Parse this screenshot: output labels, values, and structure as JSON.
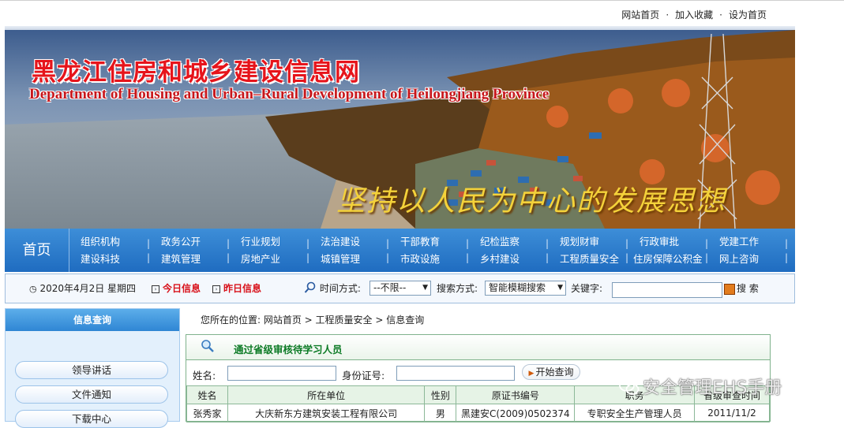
{
  "toplinks": {
    "home": "网站首页",
    "favorite": "加入收藏",
    "sethome": "设为首页",
    "sep": "·"
  },
  "banner": {
    "title_cn": "黑龙江住房和城乡建设信息网",
    "title_en": "Department of Housing and Urban–Rural Development of Heilongjiang Province",
    "slogan": "坚持以人民为中心的发展思想"
  },
  "nav": {
    "home": "首页",
    "columns": [
      [
        "政务公开",
        "建筑管理"
      ],
      [
        "行业规划",
        "房地产业"
      ],
      [
        "法治建设",
        "城镇管理"
      ],
      [
        "干部教育",
        "市政设施"
      ],
      [
        "纪检监察",
        "乡村建设"
      ],
      [
        "规划财审",
        "工程质量安全"
      ],
      [
        "行政审批",
        "住房保障公积金"
      ],
      [
        "党建工作",
        "网上咨询"
      ]
    ],
    "first_column": [
      "机构",
      "建设科技"
    ],
    "first_column_prefix": "组织"
  },
  "toolbar": {
    "date": "2020年4月2日 星期四",
    "today": "今日信息",
    "yesterday": "昨日信息",
    "time_label": "时间方式:",
    "time_value": "--不限--",
    "search_label": "搜索方式:",
    "search_value": "智能模糊搜索",
    "keyword_label": "关键字:",
    "search_button": "搜 索"
  },
  "sidebar": {
    "header": "信息查询",
    "items": [
      "领导讲话",
      "文件通知",
      "下载中心"
    ]
  },
  "breadcrumb": "您所在的位置:  网站首页 > 工程质量安全 > 信息查询",
  "panel": {
    "title": "通过省级审核待学习人员",
    "name_label": "姓名:",
    "id_label": "身份证号:",
    "query_button": "开始查询"
  },
  "table": {
    "headers": [
      "姓名",
      "所在单位",
      "性别",
      "原证书编号",
      "职务",
      "省级审查时间"
    ],
    "rows": [
      [
        "张秀家",
        "大庆新东方建筑安装工程有限公司",
        "男",
        "黑建安C(2009)0502374",
        "专职安全生产管理人员",
        "2011/11/2"
      ]
    ]
  },
  "watermark": "安全管理EHS手册"
}
